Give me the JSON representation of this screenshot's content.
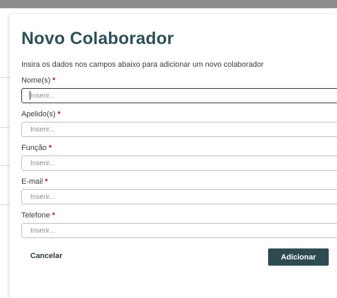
{
  "modal": {
    "title": "Novo Colaborador",
    "subtitle": "Insira os dados nos campos abaixo para adicionar um novo colaborador",
    "required_marker": "*",
    "fields": [
      {
        "label": "Nome(s)",
        "placeholder": "Inserir...",
        "value": ""
      },
      {
        "label": "Apelido(s)",
        "placeholder": "Inserir...",
        "value": ""
      },
      {
        "label": "Função",
        "placeholder": "Inserir...",
        "value": ""
      },
      {
        "label": "E-mail",
        "placeholder": "Inserir...",
        "value": ""
      },
      {
        "label": "Telefone",
        "placeholder": "Inserir...",
        "value": ""
      }
    ],
    "cancel_label": "Cancelar",
    "submit_label": "Adicionar"
  },
  "colors": {
    "title": "#2d5157",
    "required": "#b0182b",
    "primary_button": "#2d4b51"
  }
}
